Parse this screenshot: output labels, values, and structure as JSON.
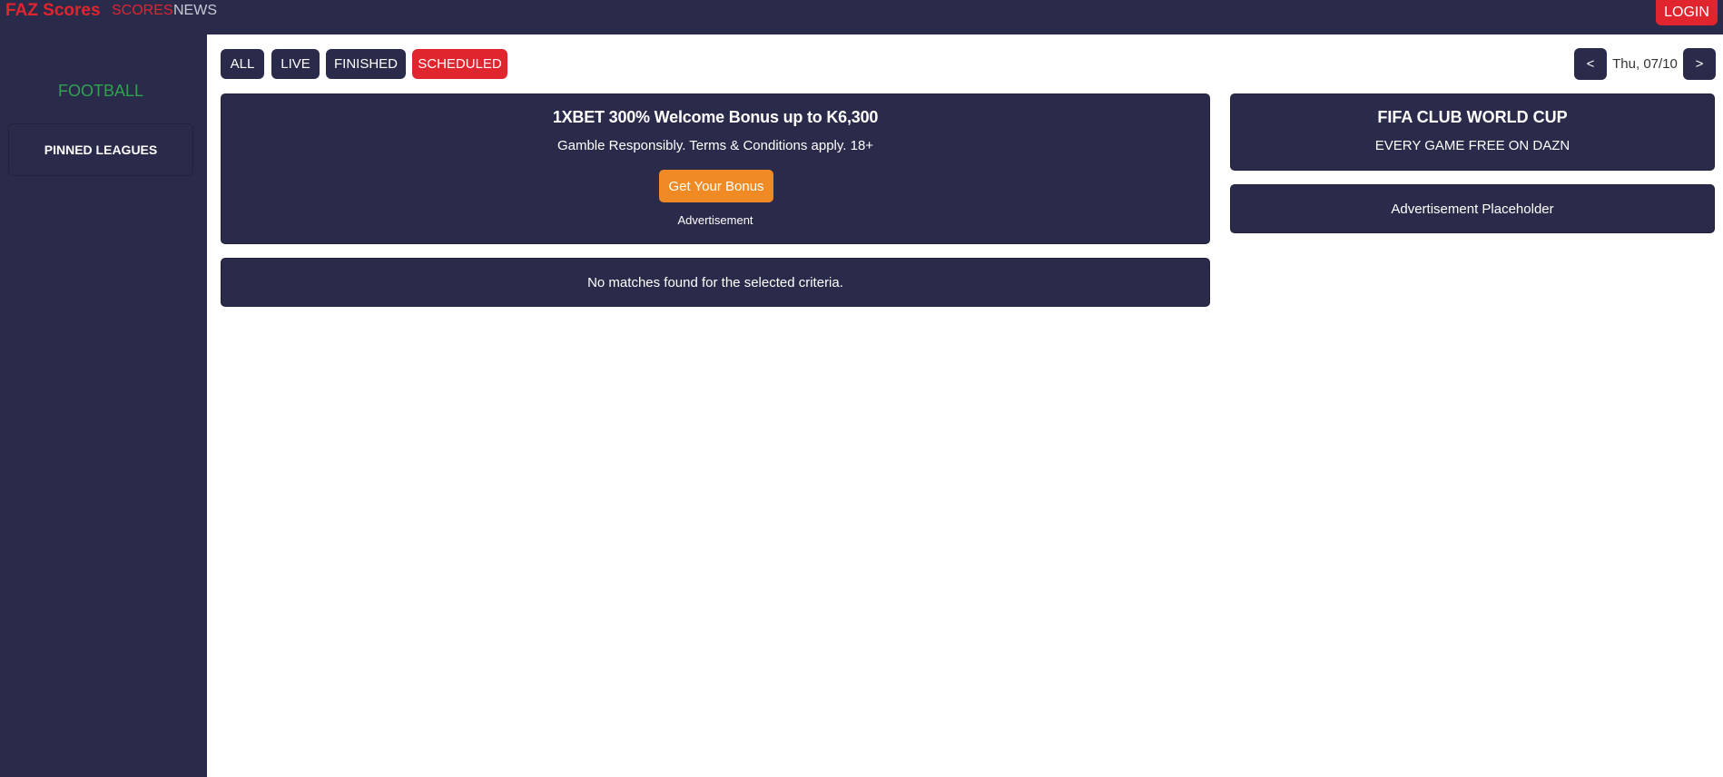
{
  "header": {
    "brand": "FAZ Scores",
    "nav": {
      "scores": "SCORES",
      "news": "NEWS"
    },
    "login_label": "LOGIN"
  },
  "sidebar": {
    "sport": "FOOTBALL",
    "pinned_label": "PINNED LEAGUES"
  },
  "filters": {
    "all": "ALL",
    "live": "LIVE",
    "finished": "FINISHED",
    "scheduled": "SCHEDULED",
    "active": "SCHEDULED"
  },
  "date_nav": {
    "prev": "<",
    "label": "Thu, 07/10",
    "next": ">"
  },
  "ad_main": {
    "title": "1XBET 300% Welcome Bonus up to K6,300",
    "subtitle": "Gamble Responsibly. Terms & Conditions apply. 18+",
    "button": "Get Your Bonus",
    "caption": "Advertisement"
  },
  "matches": {
    "empty_message": "No matches found for the selected criteria."
  },
  "side_ad": {
    "title": "FIFA CLUB WORLD CUP",
    "subtitle": "EVERY GAME FREE ON DAZN"
  },
  "side_placeholder": "Advertisement Placeholder",
  "colors": {
    "navy": "#2a2a4a",
    "accent_red": "#e0252f",
    "football_green": "#2ea44f",
    "bonus_orange": "#f08a24"
  }
}
